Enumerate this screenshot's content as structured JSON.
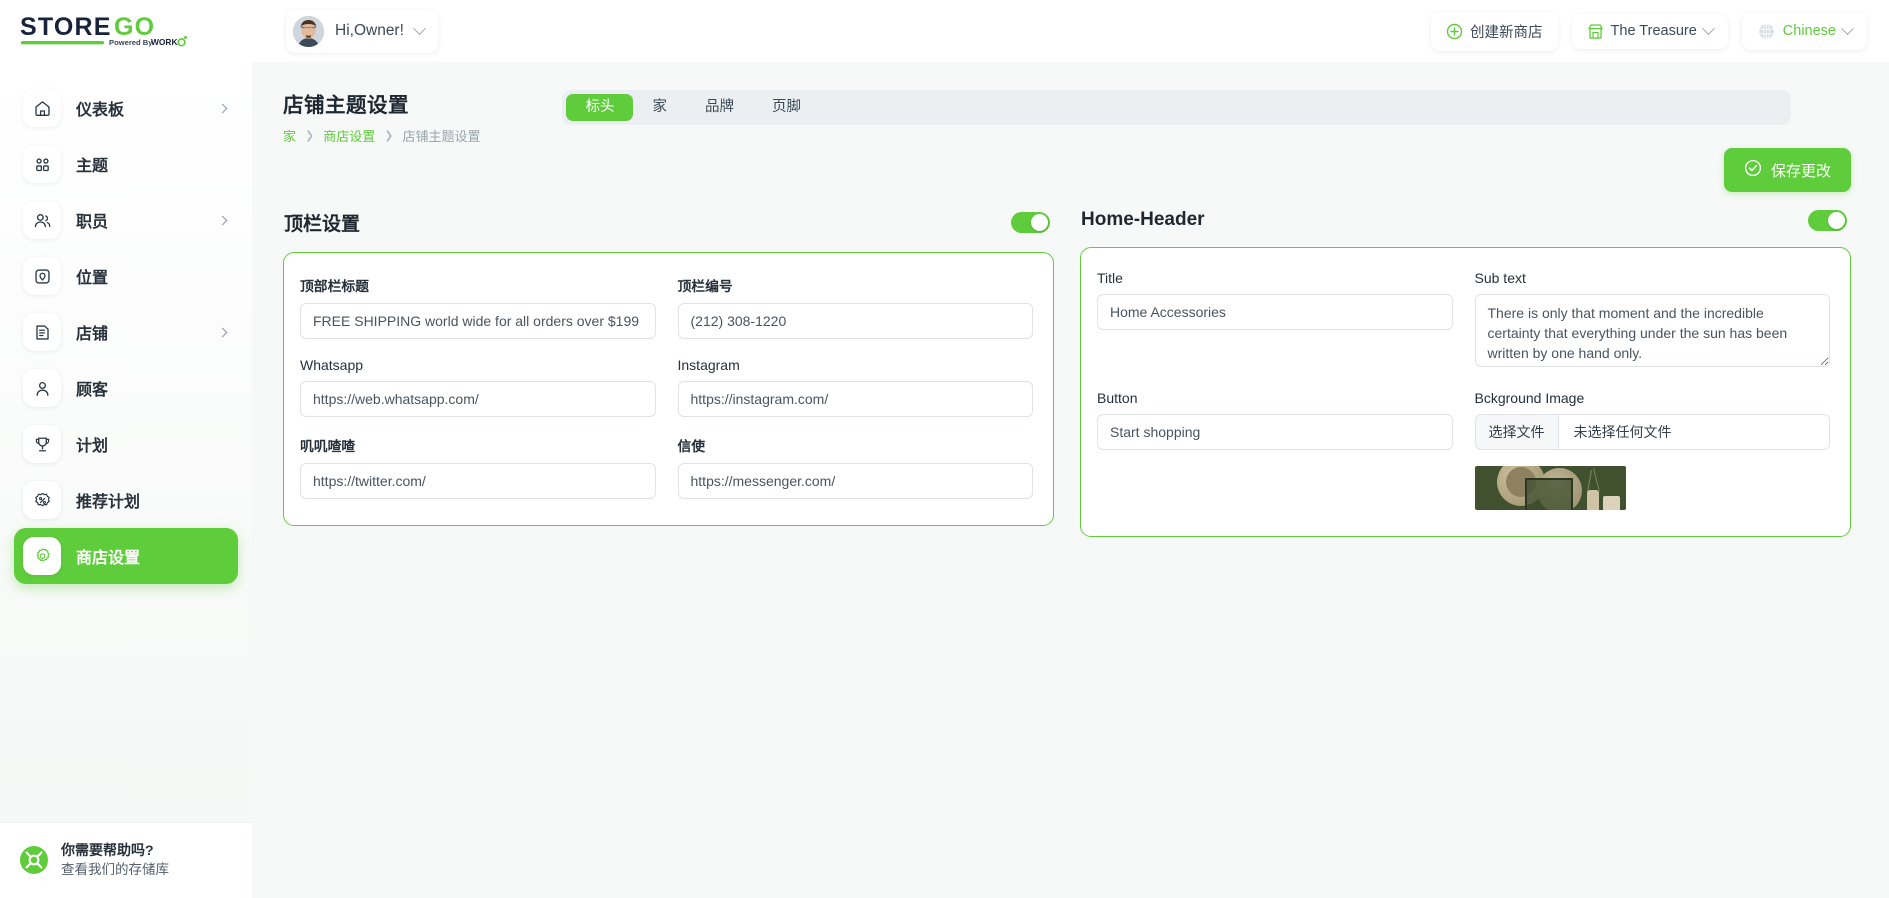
{
  "brand": {
    "logo_store": "STORE",
    "logo_go": "GO",
    "logo_tagline": "Powered By WORKDO"
  },
  "topbar": {
    "user_greeting": "Hi,Owner!",
    "create_store_label": "创建新商店",
    "store_selector_label": "The Treasure",
    "language_label": "Chinese"
  },
  "sidebar": {
    "items": [
      {
        "label": "仪表板",
        "icon": "home-icon",
        "chevron": true,
        "active": false
      },
      {
        "label": "主题",
        "icon": "grid-icon",
        "chevron": false,
        "active": false
      },
      {
        "label": "职员",
        "icon": "users-icon",
        "chevron": true,
        "active": false
      },
      {
        "label": "位置",
        "icon": "location-icon",
        "chevron": false,
        "active": false
      },
      {
        "label": "店铺",
        "icon": "store-icon",
        "chevron": true,
        "active": false
      },
      {
        "label": "顾客",
        "icon": "user-icon",
        "chevron": false,
        "active": false
      },
      {
        "label": "计划",
        "icon": "trophy-icon",
        "chevron": false,
        "active": false
      },
      {
        "label": "推荐计划",
        "icon": "percent-badge-icon",
        "chevron": false,
        "active": false
      },
      {
        "label": "商店设置",
        "icon": "gear-icon",
        "chevron": false,
        "active": true
      }
    ],
    "help": {
      "title": "你需要帮助吗?",
      "subtitle": "查看我们的存储库",
      "icon": "lifebuoy-icon"
    }
  },
  "page": {
    "title": "店铺主题设置",
    "breadcrumb": [
      "家",
      "商店设置",
      "店铺主题设置"
    ],
    "save_label": "保存更改"
  },
  "tabs": [
    {
      "label": "标头",
      "active": true
    },
    {
      "label": "家",
      "active": false
    },
    {
      "label": "品牌",
      "active": false
    },
    {
      "label": "页脚",
      "active": false
    }
  ],
  "left_panel": {
    "title": "顶栏设置",
    "enabled": true,
    "fields": {
      "topbar_title_label": "顶部栏标题",
      "topbar_title_value": "FREE SHIPPING world wide for all orders over $199",
      "topbar_number_label": "顶栏编号",
      "topbar_number_value": "(212) 308-1220",
      "whatsapp_label": "Whatsapp",
      "whatsapp_value": "https://web.whatsapp.com/",
      "instagram_label": "Instagram",
      "instagram_value": "https://instagram.com/",
      "twitter_label": "叽叽喳喳",
      "twitter_value": "https://twitter.com/",
      "messenger_label": "信使",
      "messenger_value": "https://messenger.com/"
    }
  },
  "right_panel": {
    "title": "Home-Header",
    "enabled": true,
    "fields": {
      "title_label": "Title",
      "title_value": "Home Accessories",
      "subtext_label": "Sub text",
      "subtext_value": "There is only that moment and the incredible certainty that everything under the sun has been written by one hand only.",
      "button_label": "Button",
      "button_value": "Start shopping",
      "bg_image_label": "Bckground Image",
      "file_choose_label": "选择文件",
      "file_status_label": "未选择任何文件"
    }
  },
  "colors": {
    "accent_green": "#5fcc3c",
    "logo_dark": "#17233a",
    "page_bg": "#f7f9f8",
    "text_dark": "#1f2730"
  }
}
